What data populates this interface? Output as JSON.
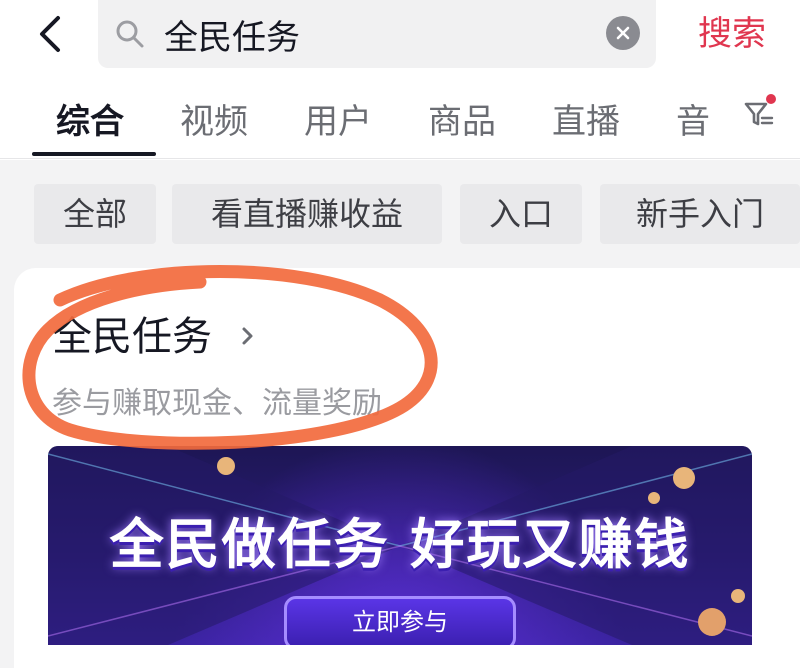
{
  "header": {
    "back_icon": "chevron-left-icon",
    "search": {
      "value": "全民任务",
      "placeholder": "",
      "search_icon": "search-icon",
      "clear_icon": "clear-circle-icon"
    },
    "search_button": "搜索"
  },
  "tabs": [
    {
      "label": "综合",
      "active": true
    },
    {
      "label": "视频",
      "active": false
    },
    {
      "label": "用户",
      "active": false
    },
    {
      "label": "商品",
      "active": false
    },
    {
      "label": "直播",
      "active": false
    },
    {
      "label": "音",
      "active": false
    }
  ],
  "filter_icon": "filter-icon",
  "chips": [
    "全部",
    "看直播赚收益",
    "入口",
    "新手入门"
  ],
  "card": {
    "title": "全民任务",
    "title_chevron": "chevron-right-icon",
    "subtitle": "参与赚取现金、流量奖励"
  },
  "banner": {
    "headline": "全民做任务 好玩又赚钱",
    "button": "立即参与"
  },
  "colors": {
    "accent": "#e0364f",
    "annotation_stroke": "#f26a3d",
    "banner_base": "#2a1c78"
  }
}
